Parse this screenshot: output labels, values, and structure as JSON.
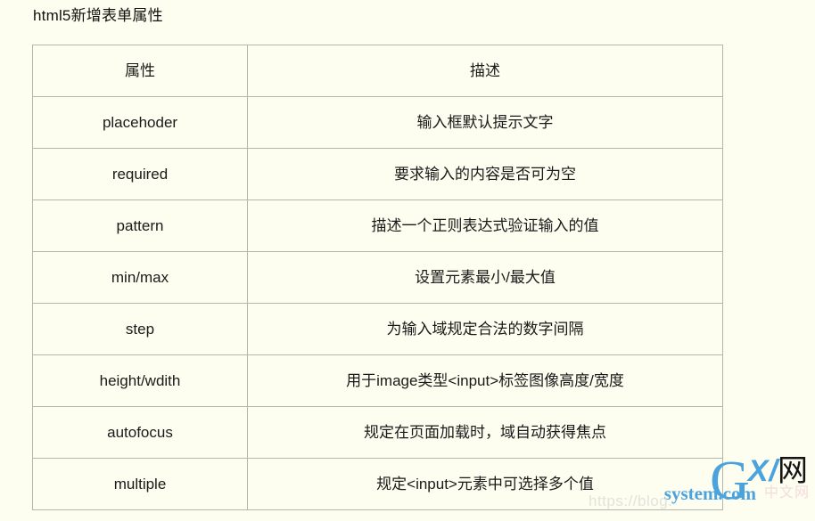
{
  "page": {
    "title": "html5新增表单属性",
    "background_color": "#fdfdf0",
    "text_color": "#1a1a1a"
  },
  "table": {
    "border_color": "#b5b5ac",
    "headers": [
      "属性",
      "描述"
    ],
    "rows": [
      {
        "attribute": "placehoder",
        "description": "输入框默认提示文字"
      },
      {
        "attribute": "required",
        "description": "要求输入的内容是否可为空"
      },
      {
        "attribute": "pattern",
        "description": "描述一个正则表达式验证输入的值"
      },
      {
        "attribute": "min/max",
        "description": "设置元素最小/最大值"
      },
      {
        "attribute": "step",
        "description": "为输入域规定合法的数字间隔"
      },
      {
        "attribute": "height/wdith",
        "description": "用于image类型<input>标签图像高度/宽度"
      },
      {
        "attribute": "autofocus",
        "description": "规定在页面加载时，域自动获得焦点"
      },
      {
        "attribute": "multiple",
        "description": "规定<input>元素中可选择多个值"
      }
    ]
  },
  "watermark": {
    "logo_g": "G",
    "logo_x": "X",
    "logo_slash": "/",
    "logo_net": "网",
    "logo_system": "system.com",
    "ghost_text": "中文网",
    "url_text": "https://blog.",
    "brand_color": "#4ba3dd"
  }
}
